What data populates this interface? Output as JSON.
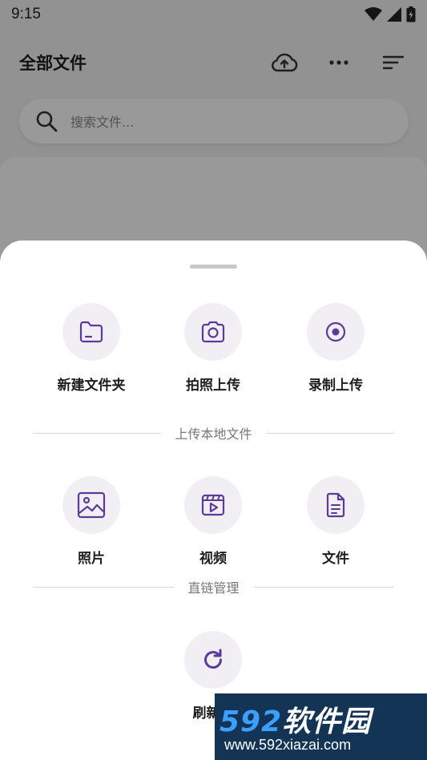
{
  "status_bar": {
    "time": "9:15"
  },
  "header": {
    "title": "全部文件"
  },
  "search": {
    "placeholder": "搜索文件..."
  },
  "sheet": {
    "top_actions": [
      {
        "label": "新建文件夹",
        "icon": "folder-icon"
      },
      {
        "label": "拍照上传",
        "icon": "camera-icon"
      },
      {
        "label": "录制上传",
        "icon": "record-icon"
      }
    ],
    "upload_section_label": "上传本地文件",
    "upload_actions": [
      {
        "label": "照片",
        "icon": "image-icon"
      },
      {
        "label": "视频",
        "icon": "video-icon"
      },
      {
        "label": "文件",
        "icon": "document-icon"
      }
    ],
    "link_section_label": "直链管理",
    "link_actions": [
      {
        "label": "刷新所",
        "icon": "refresh-icon"
      }
    ]
  },
  "watermark": {
    "brand_num": "592",
    "brand_text": "软件园",
    "url": "www.592xiazai.com"
  },
  "colors": {
    "accent": "#5b3a9b",
    "icon_bg": "#f1eff4",
    "scrim": "rgba(0,0,0,0.40)"
  }
}
